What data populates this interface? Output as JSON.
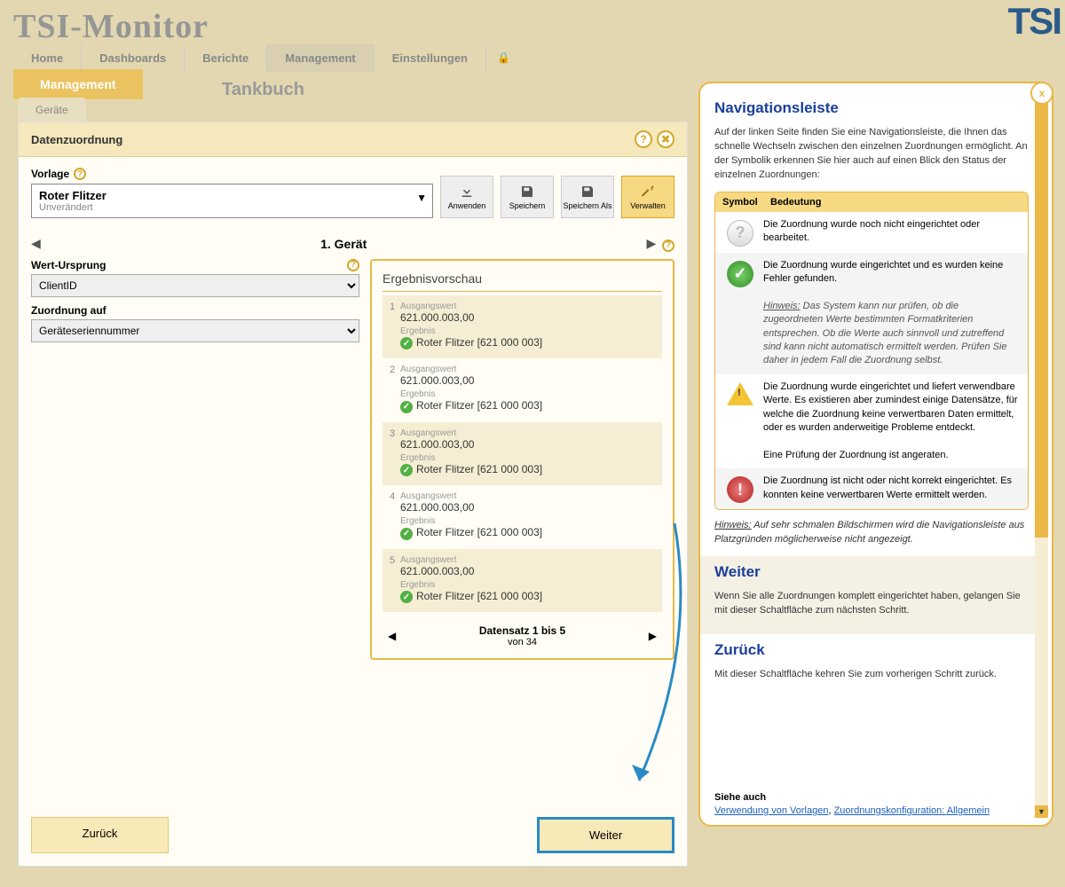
{
  "app_title": "TSI-Monitor",
  "topnav": [
    "Home",
    "Dashboards",
    "Berichte",
    "Management",
    "Einstellungen"
  ],
  "mgmt_tab": "Management",
  "sub_tab": "Geräte",
  "page_title": "Tankbuch",
  "panel": {
    "title": "Datenzuordnung"
  },
  "vorlage": {
    "label": "Vorlage",
    "name": "Roter Flitzer",
    "status": "Unverändert"
  },
  "toolbar": {
    "anwenden": "Anwenden",
    "speichern": "Speichern",
    "speichern_als": "Speichern Als",
    "verwalten": "Verwalten"
  },
  "step": {
    "title": "1. Gerät"
  },
  "form": {
    "wert_label": "Wert-Ursprung",
    "wert_value": "ClientID",
    "zu_label": "Zuordnung auf",
    "zu_value": "Geräteseriennummer"
  },
  "preview": {
    "title": "Ergebnisvorschau",
    "ausgangswert_lbl": "Ausgangswert",
    "ergebnis_lbl": "Ergebnis",
    "records": [
      {
        "n": "1",
        "src": "621.000.003,00",
        "res": "Roter Flitzer [621 000 003]"
      },
      {
        "n": "2",
        "src": "621.000.003,00",
        "res": "Roter Flitzer [621 000 003]"
      },
      {
        "n": "3",
        "src": "621.000.003,00",
        "res": "Roter Flitzer [621 000 003]"
      },
      {
        "n": "4",
        "src": "621.000.003,00",
        "res": "Roter Flitzer [621 000 003]"
      },
      {
        "n": "5",
        "src": "621.000.003,00",
        "res": "Roter Flitzer [621 000 003]"
      }
    ],
    "pager_main": "Datensatz 1 bis 5",
    "pager_sub": "von 34"
  },
  "buttons": {
    "back": "Zurück",
    "next": "Weiter"
  },
  "help": {
    "h1": "Navigationsleiste",
    "intro": "Auf der linken Seite finden Sie eine Navigationsleiste, die Ihnen das schnelle Wechseln zwischen den einzelnen Zuordnungen ermöglicht. An der Symbolik erkennen Sie hier auch auf einen Blick den Status der einzelnen Zuordnungen:",
    "th_symbol": "Symbol",
    "th_bedeutung": "Bedeutung",
    "row_q": "Die Zuordnung wurde noch nicht eingerichtet oder bearbeitet.",
    "row_ok_1": "Die Zuordnung wurde eingerichtet und es wurden keine Fehler gefunden.",
    "row_ok_hint_lbl": "Hinweis:",
    "row_ok_hint": " Das System kann nur prüfen, ob die zugeordneten Werte bestimmten Formatkriterien entsprechen. Ob die Werte auch sinnvoll und zutreffend sind kann nicht automatisch ermittelt werden. Prüfen Sie daher in jedem Fall die Zuordnung selbst.",
    "row_warn_1": "Die Zuordnung wurde eingerichtet und liefert verwendbare Werte. Es existieren aber zumindest einige Datensätze, für welche die Zuordnung keine verwertbaren Daten ermittelt, oder es wurden anderweitige Probleme entdeckt.",
    "row_warn_2": "Eine Prüfung der Zuordnung ist angeraten.",
    "row_err": "Die Zuordnung ist nicht oder nicht korrekt eingerichtet. Es konnten keine verwertbaren Werte ermittelt werden.",
    "hinweis_lbl": "Hinweis:",
    "hinweis": " Auf sehr schmalen Bildschirmen wird die Navigationsleiste aus Platzgründen möglicherweise nicht angezeigt.",
    "h_weiter": "Weiter",
    "p_weiter": "Wenn Sie alle Zuordnungen komplett eingerichtet haben, gelangen Sie mit dieser Schaltfläche zum nächsten Schritt.",
    "h_zurueck": "Zurück",
    "p_zurueck": "Mit dieser Schaltfläche kehren Sie zum vorherigen Schritt zurück.",
    "siehe": "Siehe auch",
    "link1": "Verwendung von Vorlagen",
    "link2": "Zuordnungskonfiguration: Allgemein"
  }
}
